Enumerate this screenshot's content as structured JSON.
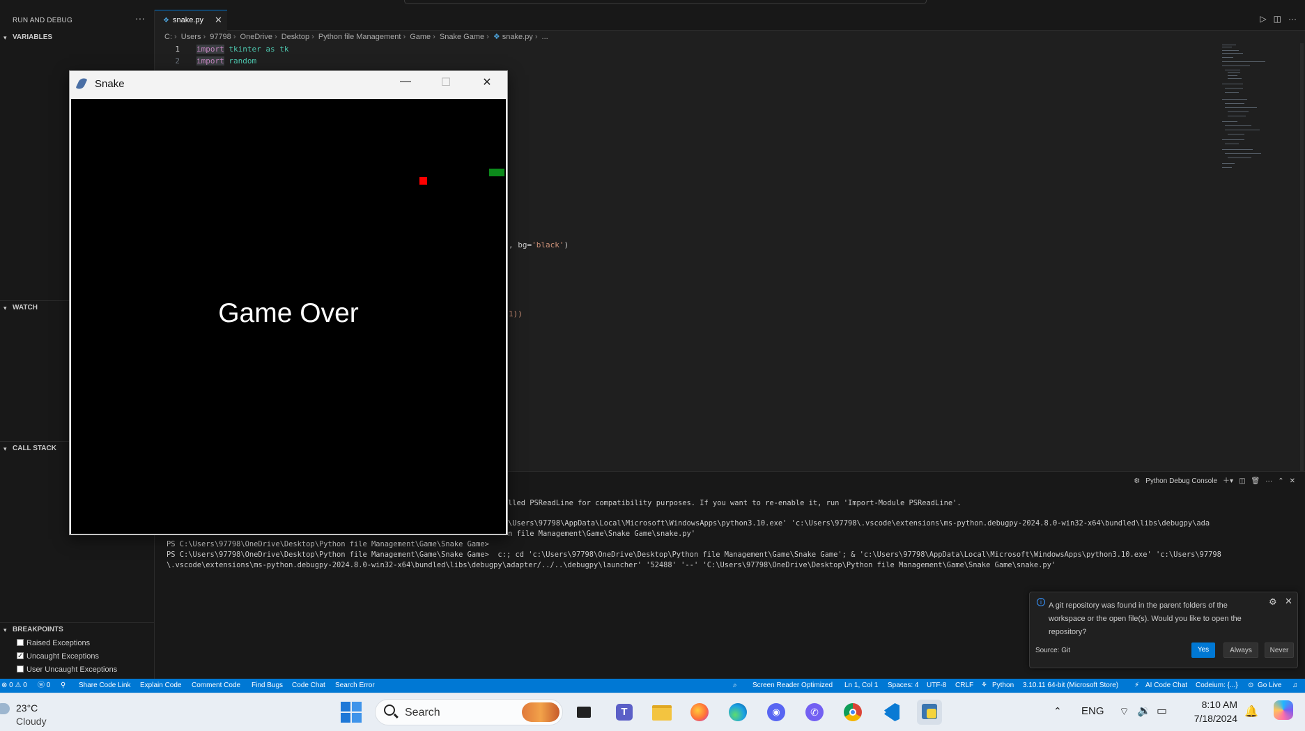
{
  "sidebar": {
    "title": "RUN AND DEBUG",
    "more": "···",
    "sections": {
      "variables": "VARIABLES",
      "watch": "WATCH",
      "call_stack": "CALL STACK",
      "breakpoints": "BREAKPOINTS"
    },
    "breakpoints": [
      {
        "label": "Raised Exceptions",
        "checked": false
      },
      {
        "label": "Uncaught Exceptions",
        "checked": true
      },
      {
        "label": "User Uncaught Exceptions",
        "checked": false
      }
    ]
  },
  "editor": {
    "tab_label": "snake.py",
    "breadcrumb": [
      "C:",
      "Users",
      "97798",
      "OneDrive",
      "Desktop",
      "Python file Management",
      "Game",
      "Snake Game",
      "snake.py",
      "..."
    ],
    "lines": [
      {
        "num": "1",
        "kw": "import",
        "rest": " tkinter as tk"
      },
      {
        "num": "2",
        "kw": "import",
        "rest": " random"
      }
    ],
    "visible_fragment_1_a": ", bg=",
    "visible_fragment_1_b": "'black'",
    "visible_fragment_1_c": ")",
    "visible_fragment_2": "1))"
  },
  "panel": {
    "console_label": "Python Debug Console",
    "terminal_lines": [
      "lled PSReadLine for compatibility purposes. If you want to re-enable it, run 'Import-Module PSReadLine'.",
      "",
      "\\Users\\97798\\AppData\\Local\\Microsoft\\WindowsApps\\python3.10.exe' 'c:\\Users\\97798\\.vscode\\extensions\\ms-python.debugpy-2024.8.0-win32-x64\\bundled\\libs\\debugpy\\ada",
      "n file Management\\Game\\Snake Game\\snake.py'",
      "PS C:\\Users\\97798\\OneDrive\\Desktop\\Python file Management\\Game\\Snake Game>",
      "PS C:\\Users\\97798\\OneDrive\\Desktop\\Python file Management\\Game\\Snake Game>  c:; cd 'c:\\Users\\97798\\OneDrive\\Desktop\\Python file Management\\Game\\Snake Game'; & 'c:\\Users\\97798\\AppData\\Local\\Microsoft\\WindowsApps\\python3.10.exe' 'c:\\Users\\97798",
      "\\.vscode\\extensions\\ms-python.debugpy-2024.8.0-win32-x64\\bundled\\libs\\debugpy\\adapter/../..\\debugpy\\launcher' '52488' '--' 'C:\\Users\\97798\\OneDrive\\Desktop\\Python file Management\\Game\\Snake Game\\snake.py'"
    ]
  },
  "notification": {
    "message": "A git repository was found in the parent folders of the workspace or the open file(s). Would you like to open the repository?",
    "source": "Source: Git",
    "yes": "Yes",
    "always": "Always",
    "never": "Never"
  },
  "statusbar": {
    "errors": "⊗ 0 ⚠ 0",
    "ports": "ⓦ 0",
    "share": "Share Code Link",
    "explain": "Explain Code",
    "comment": "Comment Code",
    "find_bugs": "Find Bugs",
    "code_chat": "Code Chat",
    "search_error": "Search Error",
    "screen_reader": "Screen Reader Optimized",
    "position": "Ln 1, Col 1",
    "spaces": "Spaces: 4",
    "encoding": "UTF-8",
    "eol": "CRLF",
    "language": "Python",
    "interpreter": "3.10.11 64-bit (Microsoft Store)",
    "ai_chat": "AI Code Chat",
    "codeium": "Codeium: {...}",
    "go_live": "Go Live"
  },
  "taskbar": {
    "temperature": "23°C",
    "condition": "Cloudy",
    "search_placeholder": "Search",
    "language": "ENG",
    "time": "8:10 AM",
    "date": "7/18/2024"
  },
  "snake_window": {
    "title": "Snake",
    "game_over": "Game Over",
    "colors": {
      "food": "#ff0000",
      "snake": "#0c8a1b",
      "background": "#000000"
    }
  }
}
